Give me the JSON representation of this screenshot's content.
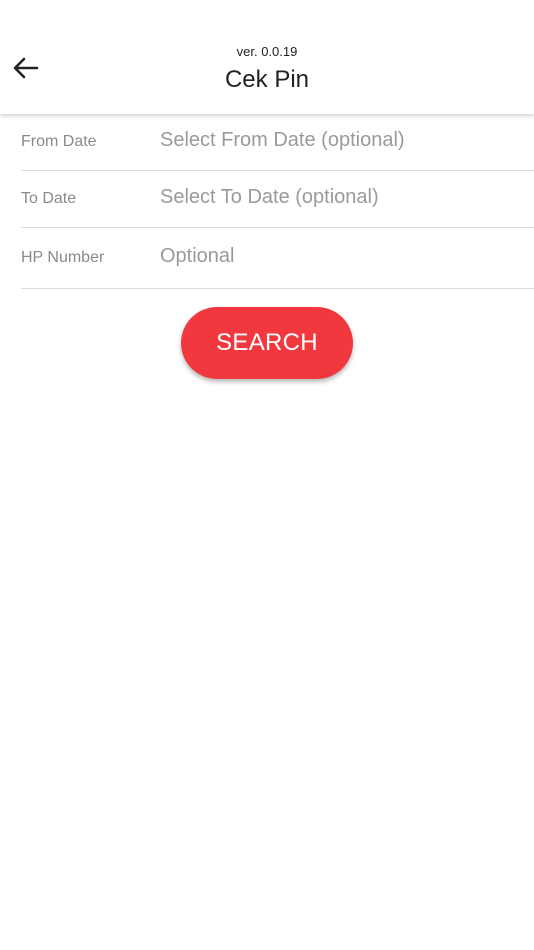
{
  "header": {
    "version": "ver. 0.0.19",
    "title": "Cek Pin",
    "back_icon": "arrow-left-icon"
  },
  "form": {
    "from_date": {
      "label": "From Date",
      "placeholder": "Select From Date (optional)"
    },
    "to_date": {
      "label": "To Date",
      "placeholder": "Select To Date (optional)"
    },
    "hp_number": {
      "label": "HP Number",
      "placeholder": "Optional"
    }
  },
  "actions": {
    "search_label": "SEARCH"
  },
  "colors": {
    "accent": "#f2383f",
    "background": "#ffffff",
    "text": "#222222",
    "muted": "#8a8a8a"
  }
}
